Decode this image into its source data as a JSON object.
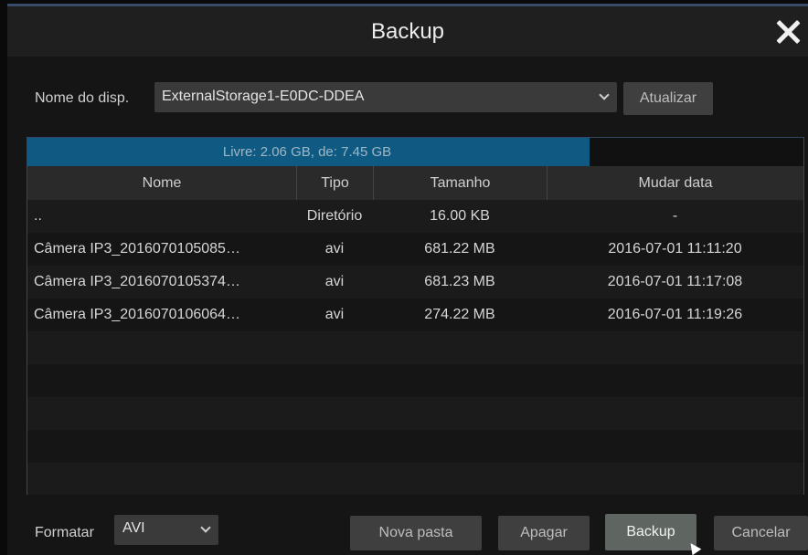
{
  "window": {
    "title": "Backup"
  },
  "device": {
    "label": "Nome do disp.",
    "selected": "ExternalStorage1-E0DC-DDEA",
    "refresh_label": "Atualizar"
  },
  "storage": {
    "text": "Livre: 2.06 GB, de: 7.45 GB",
    "used_fraction": 0.724
  },
  "table": {
    "headers": [
      "Nome",
      "Tipo",
      "Tamanho",
      "Mudar data"
    ],
    "rows": [
      {
        "name": "..",
        "type": "Diretório",
        "size": "16.00 KB",
        "date": "-"
      },
      {
        "name": "Câmera IP3_2016070105085…",
        "type": "avi",
        "size": "681.22 MB",
        "date": "2016-07-01 11:11:20"
      },
      {
        "name": "Câmera IP3_2016070105374…",
        "type": "avi",
        "size": "681.23 MB",
        "date": "2016-07-01 11:17:08"
      },
      {
        "name": "Câmera IP3_2016070106064…",
        "type": "avi",
        "size": "274.22 MB",
        "date": "2016-07-01 11:19:26"
      }
    ]
  },
  "footer": {
    "format_label": "Formatar",
    "format_value": "AVI",
    "new_folder_label": "Nova pasta",
    "delete_label": "Apagar",
    "backup_label": "Backup",
    "cancel_label": "Cancelar"
  },
  "colors": {
    "accent": "#0f5a82",
    "border": "#2e4a66",
    "selected_button": "#5f6662"
  }
}
